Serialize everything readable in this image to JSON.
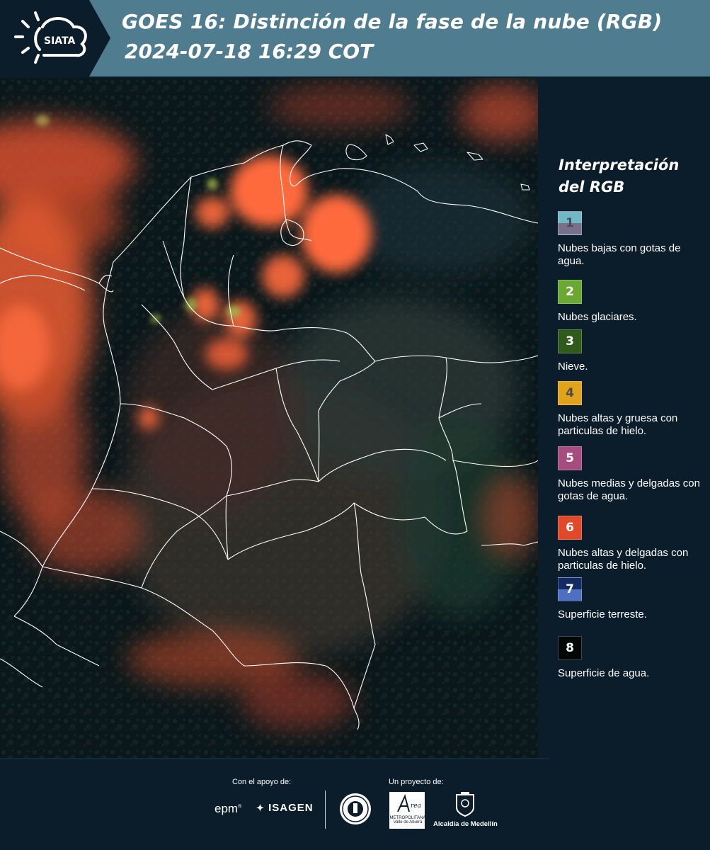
{
  "header": {
    "logo_text": "SIATA",
    "title_line1": "GOES 16: Distinción de la fase de la nube (RGB)",
    "title_line2": "2024-07-18 16:29 COT"
  },
  "legend": {
    "title": "Interpretación del RGB",
    "items": [
      {
        "num": "1",
        "label": "Nubes bajas con gotas de agua.",
        "color_top": "#6fb8c4",
        "color_bottom": "#7a6f8c",
        "num_color": "#4a4a5a"
      },
      {
        "num": "2",
        "label": "Nubes glaciares.",
        "color_top": "#6aa832",
        "color_bottom": "#6aa832",
        "num_color": "#ffffff"
      },
      {
        "num": "3",
        "label": "Nieve.",
        "color_top": "#2f5a1c",
        "color_bottom": "#2f5a1c",
        "num_color": "#ffffff"
      },
      {
        "num": "4",
        "label": "Nubes altas y gruesa con particulas de hielo.",
        "color_top": "#e1a21c",
        "color_bottom": "#e1a21c",
        "num_color": "#4a4a4a"
      },
      {
        "num": "5",
        "label": "Nubes medias y delgadas con gotas de agua.",
        "color_top": "#a64c7e",
        "color_bottom": "#a64c7e",
        "num_color": "#ffffff"
      },
      {
        "num": "6",
        "label": "Nubes altas y delgadas con particulas de hielo.",
        "color_top": "#e0492a",
        "color_bottom": "#e0492a",
        "num_color": "#ffffff"
      },
      {
        "num": "7",
        "label": "Superficie terreste.",
        "color_top": "#142a63",
        "color_bottom": "#4f6fc2",
        "num_color": "#ffffff"
      },
      {
        "num": "8",
        "label": "Superficie de agua.",
        "color_top": "#030806",
        "color_bottom": "#030806",
        "num_color": "#ffffff"
      }
    ]
  },
  "footer": {
    "support_label": "Con el apoyo de:",
    "project_label": "Un proyecto de:",
    "sponsor1": "epm",
    "sponsor2": "ISAGEN",
    "partner_amva": "METROPOLITANA Valle de Aburrá",
    "partner_medellin": "Alcaldía de Medellín"
  },
  "colors": {
    "header_band": "#4f7c8f",
    "background": "#0b1c2a",
    "cloud_orange": "#f0603a",
    "map_dark": "#07121a",
    "border_white": "#ffffff"
  }
}
